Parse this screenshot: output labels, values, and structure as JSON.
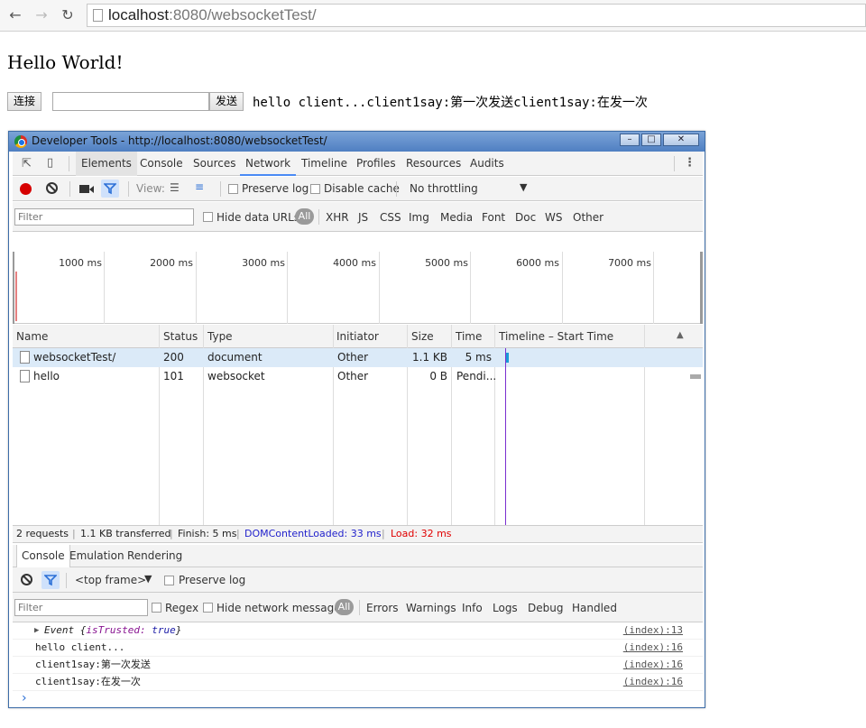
{
  "browser": {
    "url_host": "localhost",
    "url_rest": ":8080/websocketTest/"
  },
  "page": {
    "heading": "Hello World!",
    "connect_label": "连接",
    "message_value": "",
    "send_label": "发送",
    "messages": "hello client...client1say:第一次发送client1say:在发一次"
  },
  "devtools": {
    "window_title": "Developer Tools - http://localhost:8080/websocketTest/",
    "tabs": [
      "Elements",
      "Console",
      "Sources",
      "Network",
      "Timeline",
      "Profiles",
      "Resources",
      "Audits"
    ],
    "toolbar": {
      "view_label": "View:",
      "preserve_log": "Preserve log",
      "disable_cache": "Disable cache",
      "throttling": "No throttling"
    },
    "filter": {
      "placeholder": "Filter",
      "hide_data_urls": "Hide data URLs",
      "all": "All",
      "types": [
        "XHR",
        "JS",
        "CSS",
        "Img",
        "Media",
        "Font",
        "Doc",
        "WS",
        "Other"
      ]
    },
    "overview_ticks": [
      "1000 ms",
      "2000 ms",
      "3000 ms",
      "4000 ms",
      "5000 ms",
      "6000 ms",
      "7000 ms"
    ],
    "columns": [
      "Name",
      "Status",
      "Type",
      "Initiator",
      "Size",
      "Time",
      "Timeline – Start Time"
    ],
    "rows": [
      {
        "name": "websocketTest/",
        "status": "200",
        "type": "document",
        "initiator": "Other",
        "size": "1.1 KB",
        "time": "5 ms"
      },
      {
        "name": "hello",
        "status": "101",
        "type": "websocket",
        "initiator": "Other",
        "size": "0 B",
        "time": "Pendi..."
      }
    ],
    "summary": {
      "requests": "2 requests",
      "transferred": "1.1 KB transferred",
      "finish": "Finish: 5 ms",
      "dcl": "DOMContentLoaded: 33 ms",
      "load": "Load: 32 ms"
    },
    "drawer_tabs": [
      "Console",
      "Emulation",
      "Rendering"
    ],
    "console_toolbar": {
      "frame": "<top frame>",
      "preserve_log": "Preserve log"
    },
    "console_filter": {
      "placeholder": "Filter",
      "regex": "Regex",
      "hide_network": "Hide network messages",
      "all": "All",
      "levels": [
        "Errors",
        "Warnings",
        "Info",
        "Logs",
        "Debug",
        "Handled"
      ]
    },
    "console_lines": [
      {
        "event_name": "Event",
        "event_key": "isTrusted:",
        "event_value": "true",
        "source": "(index):13"
      },
      {
        "text": "hello client...",
        "source": "(index):16"
      },
      {
        "text": "client1say:第一次发送",
        "source": "(index):16"
      },
      {
        "text": "client1say:在发一次",
        "source": "(index):16"
      }
    ],
    "prompt": "›"
  },
  "colors": {
    "accent": "#4a8af4",
    "record": "#d60000",
    "dcl": "#2222cc",
    "load": "#e00000"
  }
}
